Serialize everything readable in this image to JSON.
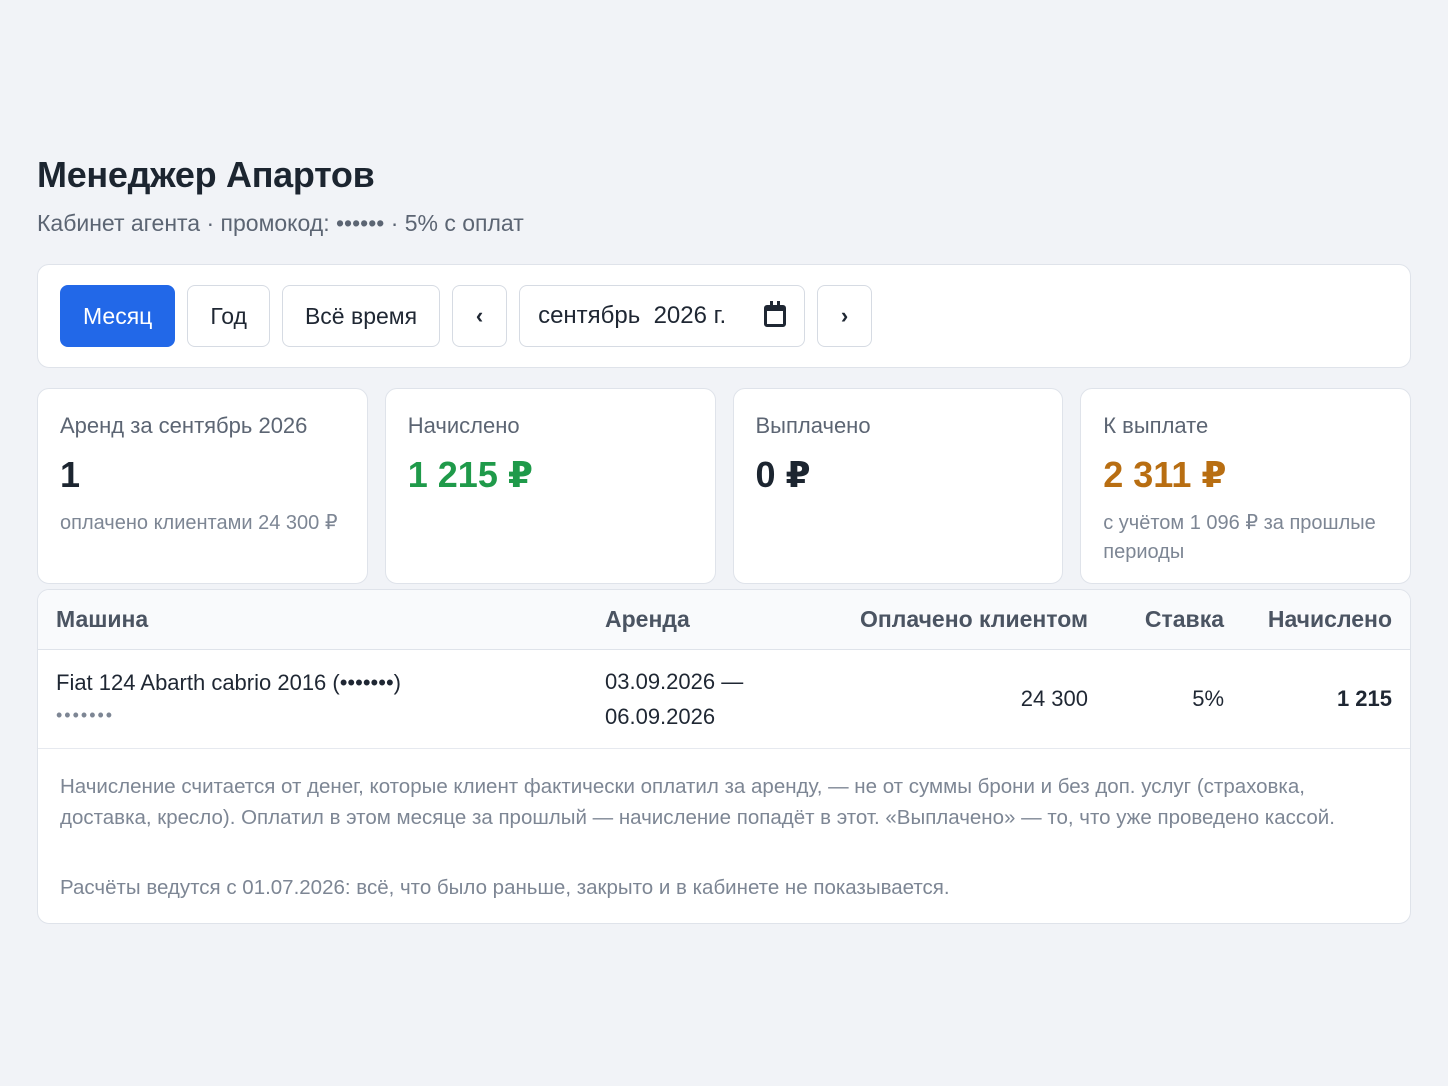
{
  "header": {
    "title": "Менеджер Апартов",
    "subtitle": "Кабинет агента · промокод: •••••• · 5% с оплат"
  },
  "toolbar": {
    "period_month": "Месяц",
    "period_year": "Год",
    "period_all": "Всё время",
    "prev": "‹",
    "next": "›",
    "date_value": "сентябрь  2026 г.",
    "selected_period": "Месяц"
  },
  "cards": {
    "rentals": {
      "label": "Аренд за сентябрь 2026",
      "value": "1",
      "note": "оплачено клиентами 24 300 ₽"
    },
    "accrued": {
      "label": "Начислено",
      "value": "1 215 ₽"
    },
    "paid": {
      "label": "Выплачено",
      "value": "0 ₽"
    },
    "to_pay": {
      "label": "К выплате",
      "value": "2 311 ₽",
      "note": "с учётом 1 096 ₽ за прошлые периоды"
    }
  },
  "colors": {
    "accent": "#2268e8",
    "accrued": "#1f9a4a",
    "to_pay": "#b86e12"
  },
  "table": {
    "headers": {
      "car": "Машина",
      "rental": "Аренда",
      "paid_by_client": "Оплачено клиентом",
      "rate": "Ставка",
      "accrued": "Начислено"
    },
    "rows": [
      {
        "car": "Fiat 124 Abarth cabrio 2016 (•••••••)",
        "plate": "•••••••",
        "rental_from": "03.09.2026 —",
        "rental_to": "06.09.2026",
        "paid_by_client": "24 300",
        "rate": "5%",
        "accrued": "1 215"
      }
    ]
  },
  "notes": {
    "p1": "Начисление считается от денег, которые клиент фактически оплатил за аренду, — не от суммы брони и без доп. услуг (страховка, доставка, кресло). Оплатил в этом месяце за прошлый — начисление попадёт в этот. «Выплачено» — то, что уже проведено кассой.",
    "p2": "Расчёты ведутся с 01.07.2026: всё, что было раньше, закрыто и в кабинете не показывается."
  }
}
